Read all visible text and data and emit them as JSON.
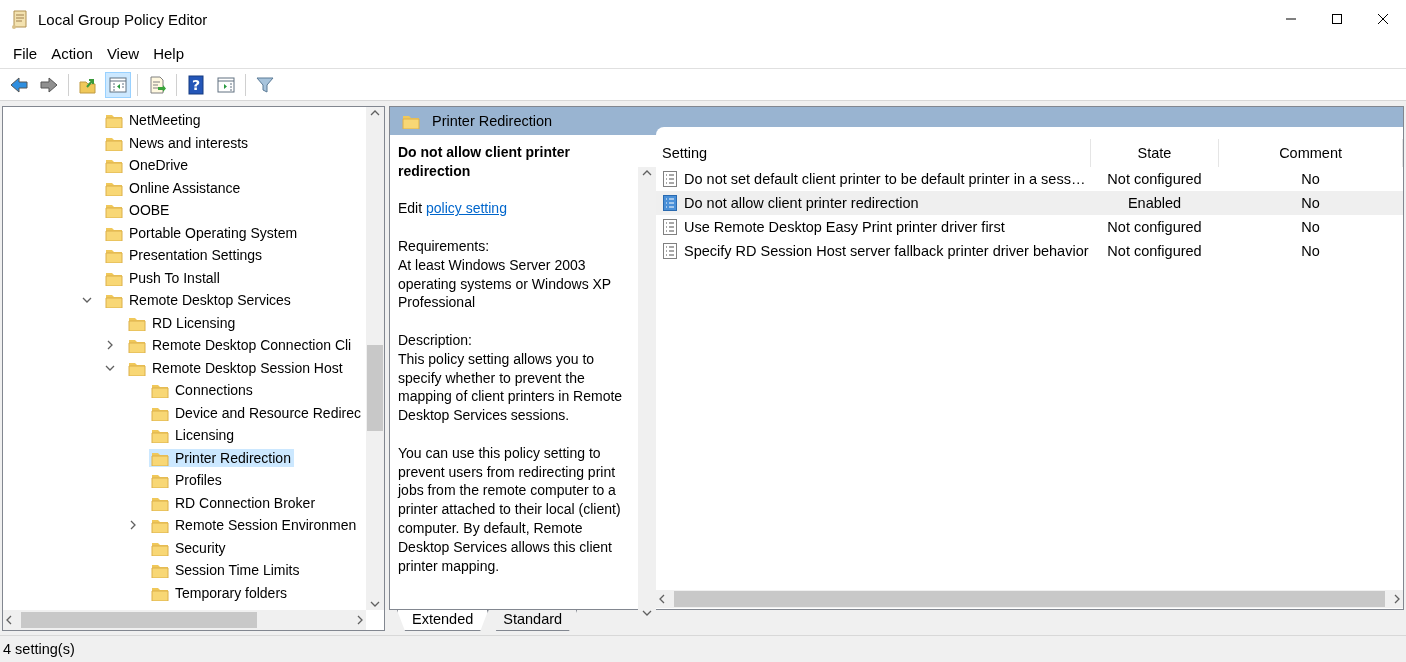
{
  "window": {
    "title": "Local Group Policy Editor"
  },
  "menu": [
    {
      "label": "File"
    },
    {
      "label": "Action"
    },
    {
      "label": "View"
    },
    {
      "label": "Help"
    }
  ],
  "toolbar": {
    "groups": [
      {
        "buttons": [
          {
            "kind": "back",
            "pressed": false,
            "disabled": false
          },
          {
            "kind": "forward",
            "pressed": false,
            "disabled": true
          }
        ]
      },
      {
        "buttons": [
          {
            "kind": "up",
            "pressed": false,
            "disabled": false
          },
          {
            "kind": "tree-toggle",
            "pressed": true,
            "disabled": false
          }
        ]
      },
      {
        "buttons": [
          {
            "kind": "export",
            "pressed": false,
            "disabled": false
          }
        ]
      },
      {
        "buttons": [
          {
            "kind": "help",
            "glyph": "?",
            "pressed": false,
            "disabled": false
          },
          {
            "kind": "action-pane",
            "pressed": false,
            "disabled": false
          }
        ]
      },
      {
        "buttons": [
          {
            "kind": "filter",
            "pressed": false,
            "disabled": false
          }
        ]
      }
    ]
  },
  "tree": {
    "items": [
      {
        "label": "NetMeeting",
        "selected": false,
        "kind": "leaf"
      },
      {
        "label": "News and interests",
        "selected": false,
        "kind": "leaf"
      },
      {
        "label": "OneDrive",
        "selected": false,
        "kind": "leaf"
      },
      {
        "label": "Online Assistance",
        "selected": false,
        "kind": "leaf"
      },
      {
        "label": "OOBE",
        "selected": false,
        "kind": "leaf"
      },
      {
        "label": "Portable Operating System",
        "selected": false,
        "kind": "leaf"
      },
      {
        "label": "Presentation Settings",
        "selected": false,
        "kind": "leaf"
      },
      {
        "label": "Push To Install",
        "selected": false,
        "kind": "leaf"
      },
      {
        "label": "Remote Desktop Services",
        "selected": false,
        "kind": "branch",
        "expanded": true,
        "children": [
          {
            "label": "RD Licensing",
            "selected": false,
            "kind": "leaf"
          },
          {
            "label": "Remote Desktop Connection Cli",
            "selected": false,
            "kind": "branch",
            "expanded": false
          },
          {
            "label": "Remote Desktop Session Host",
            "selected": false,
            "kind": "branch",
            "expanded": true,
            "children": [
              {
                "label": "Connections",
                "selected": false,
                "kind": "leaf"
              },
              {
                "label": "Device and Resource Redirec",
                "selected": false,
                "kind": "leaf"
              },
              {
                "label": "Licensing",
                "selected": false,
                "kind": "leaf"
              },
              {
                "label": "Printer Redirection",
                "selected": true,
                "kind": "leaf"
              },
              {
                "label": "Profiles",
                "selected": false,
                "kind": "leaf"
              },
              {
                "label": "RD Connection Broker",
                "selected": false,
                "kind": "leaf"
              },
              {
                "label": "Remote Session Environmen",
                "selected": false,
                "kind": "branch",
                "expanded": false
              },
              {
                "label": "Security",
                "selected": false,
                "kind": "leaf"
              },
              {
                "label": "Session Time Limits",
                "selected": false,
                "kind": "leaf"
              },
              {
                "label": "Temporary folders",
                "selected": false,
                "kind": "leaf"
              }
            ]
          }
        ]
      }
    ]
  },
  "details": {
    "header": "Printer Redirection",
    "title": "Do not allow client printer redirection",
    "edit_prefix": "Edit",
    "edit_link": "policy setting",
    "sections": [
      {
        "heading": "Requirements:",
        "body": "At least Windows Server 2003 operating systems or Windows XP Professional"
      },
      {
        "heading": "Description:",
        "body": "This policy setting allows you to specify whether to prevent the mapping of client printers in Remote Desktop Services sessions."
      },
      {
        "body": "You can use this policy setting to prevent users from redirecting print jobs from the remote computer to a printer attached to their local (client) computer. By default, Remote Desktop Services allows this client printer mapping."
      }
    ]
  },
  "table": {
    "columns": [
      "Setting",
      "State",
      "Comment"
    ],
    "rows": [
      {
        "setting": "Do not set default client printer to be default printer in a sess…",
        "state": "Not configured",
        "comment": "No",
        "selected": false
      },
      {
        "setting": "Do not allow client printer redirection",
        "state": "Enabled",
        "comment": "No",
        "selected": true
      },
      {
        "setting": "Use Remote Desktop Easy Print printer driver first",
        "state": "Not configured",
        "comment": "No",
        "selected": false
      },
      {
        "setting": "Specify RD Session Host server fallback printer driver behavior",
        "state": "Not configured",
        "comment": "No",
        "selected": false
      }
    ]
  },
  "tabs": [
    {
      "label": "Extended",
      "selected": true
    },
    {
      "label": "Standard",
      "selected": false
    }
  ],
  "status_bar": {
    "text": "4 setting(s)"
  }
}
